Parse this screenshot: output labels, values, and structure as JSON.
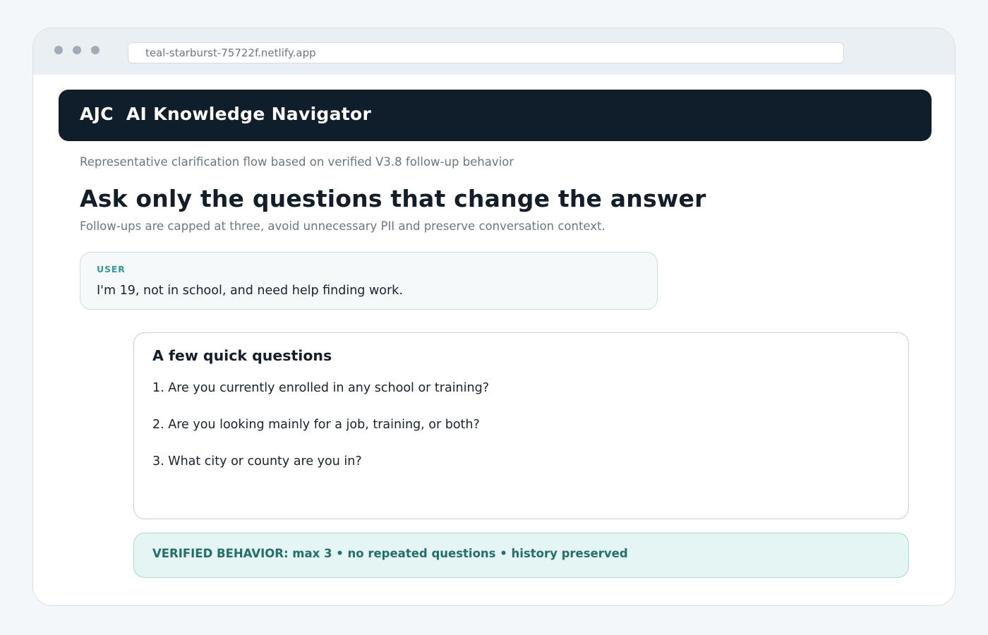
{
  "browser": {
    "url": "teal-starburst-75722f.netlify.app"
  },
  "app": {
    "title": "AJC  AI Knowledge Navigator"
  },
  "page": {
    "context_note": "Representative clarification flow based on verified V3.8 follow-up behavior",
    "headline": "Ask only the questions that change the answer",
    "subline": "Follow-ups are capped at three, avoid unnecessary PII and preserve conversation context."
  },
  "user_message": {
    "role": "USER",
    "text": "I'm 19, not in school, and need help finding work."
  },
  "questions_card": {
    "title": "A few quick questions",
    "items": [
      "1. Are you currently enrolled in any school or training?",
      "2. Are you looking mainly for a job, training, or both?",
      "3. What city or county are you in?"
    ]
  },
  "verified_banner": {
    "text": "VERIFIED BEHAVIOR: max 3 • no repeated questions • history preserved"
  },
  "colors": {
    "header_bg": "#101e2b",
    "accent_teal": "#2c9b95",
    "verified_bg": "#e4f5f3",
    "verified_text": "#236f6a"
  }
}
